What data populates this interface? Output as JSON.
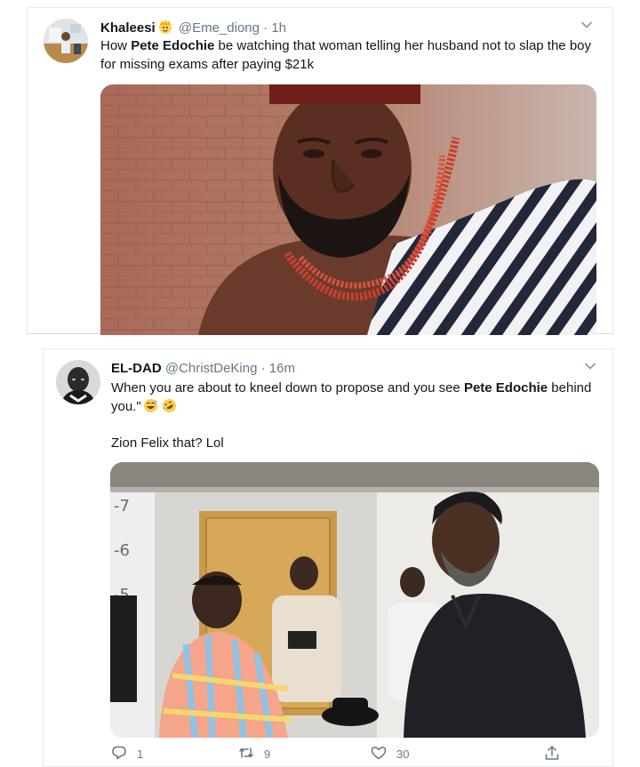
{
  "tweet1": {
    "author_name": "Khaleesi",
    "handle": "@Eme_diong",
    "separator": "·",
    "time": "1h",
    "text_before": "How ",
    "text_bold": "Pete Edochie",
    "text_after": " be watching that woman telling her husband not to slap the boy for missing exams after paying $21k",
    "name_emoji": "princess-emoji",
    "avatar": "user-avatar"
  },
  "tweet2": {
    "author_name": "EL-DAD",
    "handle": "@ChristDeKing",
    "separator": "·",
    "time": "16m",
    "text_before": "When you are about to kneel down to propose and you see ",
    "text_bold": "Pete Edochie",
    "text_after": " behind you.\"",
    "text_emojis": [
      "grinning-sweat-emoji",
      "rofl-emoji"
    ],
    "text_line2": "Zion Felix that? Lol",
    "avatar": "user-avatar",
    "actions": {
      "reply_count": "1",
      "retweet_count": "9",
      "like_count": "30"
    }
  },
  "colors": {
    "text": "#14171a",
    "muted": "#657786",
    "border": "#e6ecf0"
  }
}
